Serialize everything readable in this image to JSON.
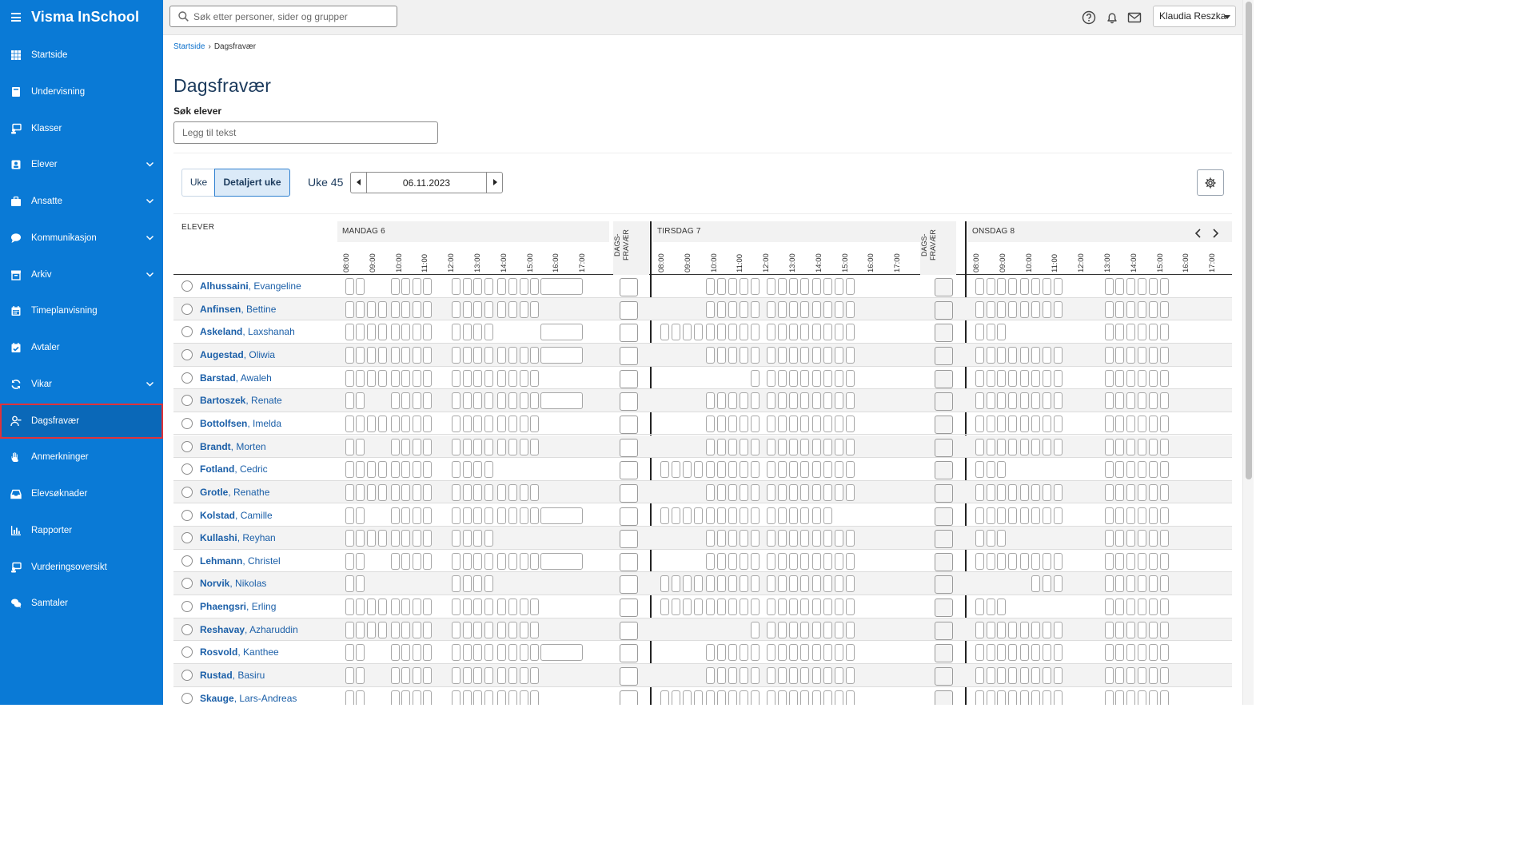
{
  "app": {
    "title": "Visma InSchool"
  },
  "sidebar": {
    "items": [
      {
        "label": "Startside",
        "icon": "grid-icon",
        "has_chevron": false,
        "active": false
      },
      {
        "label": "Undervisning",
        "icon": "book-icon",
        "has_chevron": false,
        "active": false
      },
      {
        "label": "Klasser",
        "icon": "classroom-icon",
        "has_chevron": false,
        "active": false
      },
      {
        "label": "Elever",
        "icon": "student-icon",
        "has_chevron": true,
        "active": false
      },
      {
        "label": "Ansatte",
        "icon": "briefcase-icon",
        "has_chevron": true,
        "active": false
      },
      {
        "label": "Kommunikasjon",
        "icon": "chat-bubble-icon",
        "has_chevron": true,
        "active": false
      },
      {
        "label": "Arkiv",
        "icon": "archive-icon",
        "has_chevron": true,
        "active": false
      },
      {
        "label": "Timeplanvisning",
        "icon": "calendar-icon",
        "has_chevron": false,
        "active": false
      },
      {
        "label": "Avtaler",
        "icon": "calendar-check-icon",
        "has_chevron": false,
        "active": false
      },
      {
        "label": "Vikar",
        "icon": "refresh-icon",
        "has_chevron": true,
        "active": false
      },
      {
        "label": "Dagsfravær",
        "icon": "user-absence-icon",
        "has_chevron": false,
        "active": true
      },
      {
        "label": "Anmerkninger",
        "icon": "hand-icon",
        "has_chevron": false,
        "active": false
      },
      {
        "label": "Elevsøknader",
        "icon": "inbox-icon",
        "has_chevron": false,
        "active": false
      },
      {
        "label": "Rapporter",
        "icon": "bar-chart-icon",
        "has_chevron": false,
        "active": false
      },
      {
        "label": "Vurderingsoversikt",
        "icon": "assessment-icon",
        "has_chevron": false,
        "active": false
      },
      {
        "label": "Samtaler",
        "icon": "conversation-icon",
        "has_chevron": false,
        "active": false
      }
    ]
  },
  "topbar": {
    "search_placeholder": "Søk etter personer, sider og grupper",
    "user_name": "Klaudia Reszka"
  },
  "breadcrumb": {
    "home": "Startside",
    "current": "Dagsfravær"
  },
  "page": {
    "title": "Dagsfravær",
    "search_label": "Søk elever",
    "search_placeholder": "Legg til tekst"
  },
  "toolbar": {
    "view_week": "Uke",
    "view_detailed": "Detaljert uke",
    "week_label": "Uke 45",
    "date": "06.11.2023"
  },
  "grid": {
    "column_students": "ELEVER",
    "dags_label": "DAGS-FRAVÆR",
    "times": [
      "08:00",
      "09:00",
      "10:00",
      "11:00",
      "12:00",
      "13:00",
      "14:00",
      "15:00",
      "16:00",
      "17:00"
    ],
    "days": [
      "MANDAG 6",
      "TIRSDAG 7",
      "ONSDAG 8"
    ],
    "students": [
      {
        "last": "Alhussaini",
        "first": "Evangeline"
      },
      {
        "last": "Anfinsen",
        "first": "Bettine"
      },
      {
        "last": "Askeland",
        "first": "Laxshanah"
      },
      {
        "last": "Augestad",
        "first": "Oliwia"
      },
      {
        "last": "Barstad",
        "first": "Awaleh"
      },
      {
        "last": "Bartoszek",
        "first": "Renate"
      },
      {
        "last": "Bottolfsen",
        "first": "Imelda"
      },
      {
        "last": "Brandt",
        "first": "Morten"
      },
      {
        "last": "Fotland",
        "first": "Cedric"
      },
      {
        "last": "Grotle",
        "first": "Renathe"
      },
      {
        "last": "Kolstad",
        "first": "Camille"
      },
      {
        "last": "Kullashi",
        "first": "Reyhan"
      },
      {
        "last": "Lehmann",
        "first": "Christel"
      },
      {
        "last": "Norvik",
        "first": "Nikolas"
      },
      {
        "last": "Phaengsri",
        "first": "Erling"
      },
      {
        "last": "Reshavay",
        "first": "Azharuddin"
      },
      {
        "last": "Rosvold",
        "first": "Kanthee"
      },
      {
        "last": "Rustad",
        "first": "Basiru"
      },
      {
        "last": "Skauge",
        "first": "Lars-Andreas"
      }
    ]
  },
  "colors": {
    "sidebar_bg": "#0a7ad6",
    "accent": "#0a6fcb",
    "active_outline": "#e0323a"
  }
}
